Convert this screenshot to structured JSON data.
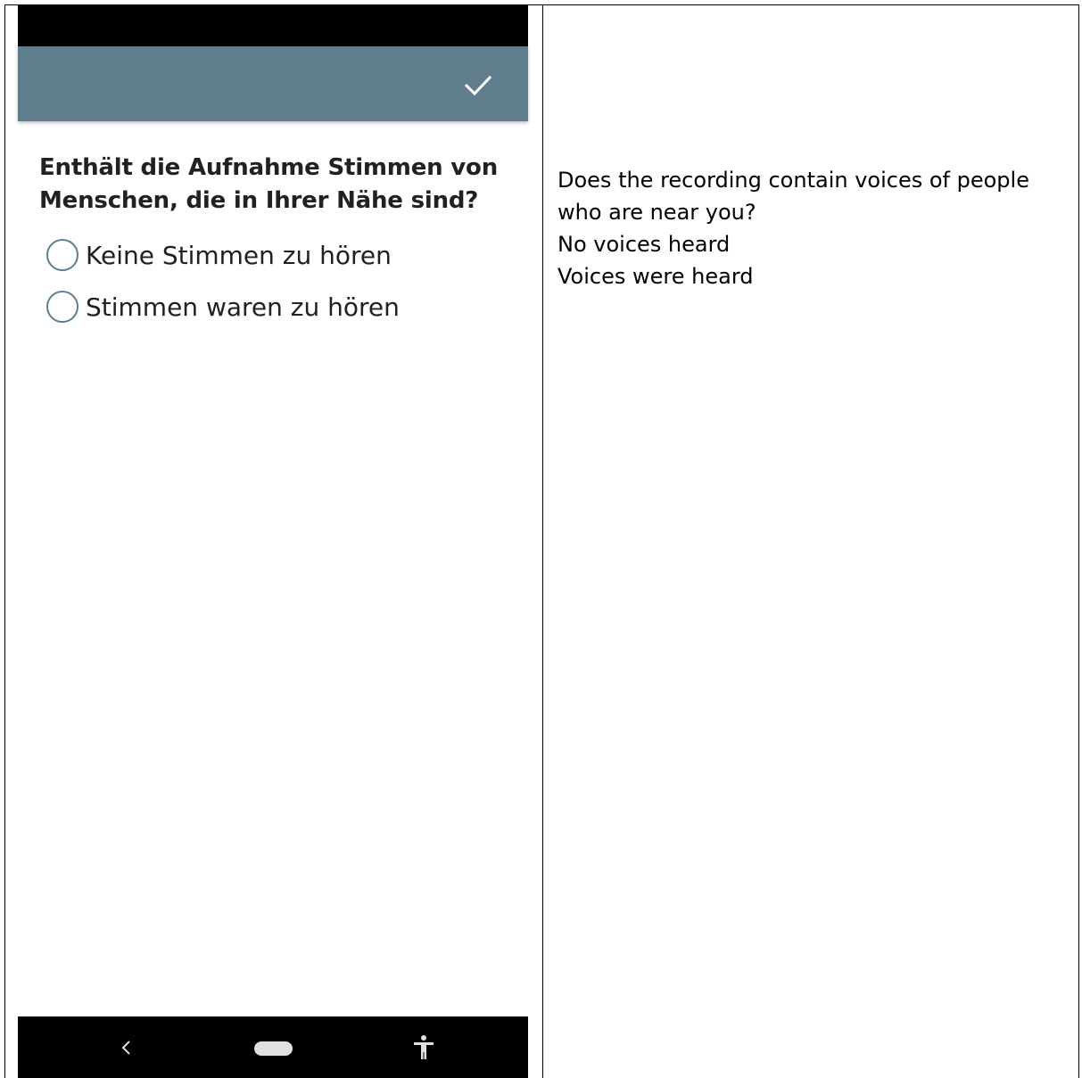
{
  "app_bar": {
    "color": "#607d8b",
    "confirm_icon": "check-icon"
  },
  "question": {
    "text": "Enthält die Aufnahme Stimmen von Menschen, die in Ihrer Nähe sind?"
  },
  "options": [
    {
      "label": "Keine Stimmen zu hören",
      "selected": false
    },
    {
      "label": "Stimmen waren zu hören",
      "selected": false
    }
  ],
  "nav_bar": {
    "back_icon": "back-chevron-icon",
    "home_icon": "home-pill-icon",
    "accessibility_icon": "accessibility-icon"
  },
  "translation": {
    "question_line1": "Does the recording contain voices of people",
    "question_line2": "who are near you?",
    "option1": "No voices heard",
    "option2": "Voices were heard"
  }
}
